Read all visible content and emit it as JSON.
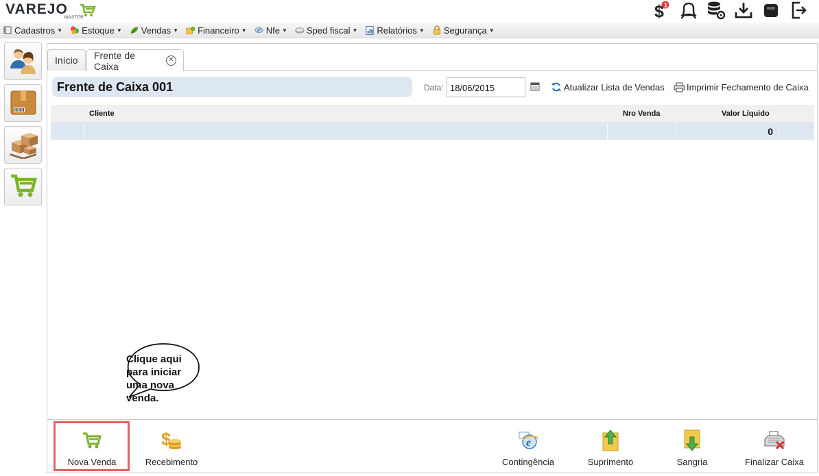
{
  "app": {
    "logo_text": "VAREJO",
    "logo_sub": "MASTER",
    "brand_color": "#7ab32e"
  },
  "top_icons": [
    {
      "name": "dollar-notification-icon",
      "badge": "1"
    },
    {
      "name": "support-agent-icon"
    },
    {
      "name": "database-settings-icon"
    },
    {
      "name": "download-icon"
    },
    {
      "name": "printer-icon"
    },
    {
      "name": "logout-icon"
    }
  ],
  "menu": [
    {
      "label": "Cadastros",
      "icon": "cadastros-icon"
    },
    {
      "label": "Estoque",
      "icon": "estoque-icon"
    },
    {
      "label": "Vendas",
      "icon": "vendas-icon"
    },
    {
      "label": "Financeiro",
      "icon": "financeiro-icon"
    },
    {
      "label": "Nfe",
      "icon": "nfe-icon"
    },
    {
      "label": "Sped fiscal",
      "icon": "sped-icon"
    },
    {
      "label": "Relatórios",
      "icon": "relatorios-icon"
    },
    {
      "label": "Segurança",
      "icon": "seguranca-icon"
    }
  ],
  "sidebar": [
    {
      "name": "clientes-icon"
    },
    {
      "name": "produtos-box-icon"
    },
    {
      "name": "estoque-boxes-icon"
    },
    {
      "name": "cart-icon"
    }
  ],
  "tabs": [
    {
      "label": "Início"
    },
    {
      "label": "Frente de Caixa",
      "closable": true
    }
  ],
  "page": {
    "title": "Frente de Caixa 001",
    "date_label": "Data:",
    "date_value": "18/06/2015",
    "refresh_label": "Atualizar Lista de Vendas",
    "print_label": "Imprimir Fechamento de Caixa"
  },
  "grid": {
    "columns": [
      "Cliente",
      "Nro Venda",
      "Valor Líquido"
    ],
    "rows": [
      {
        "cliente": "",
        "nro_venda": "",
        "valor_liquido": "0"
      }
    ]
  },
  "toolbar": {
    "nova_venda": "Nova Venda",
    "recebimento": "Recebimento",
    "contingencia": "Contingência",
    "suprimento": "Suprimento",
    "sangria": "Sangria",
    "finalizar_caixa": "Finalizar Caixa"
  },
  "callout": {
    "text_lines": [
      "Clique aqui",
      "para iniciar",
      "uma nova",
      "venda."
    ],
    "highlight_color": "#e0625e"
  }
}
